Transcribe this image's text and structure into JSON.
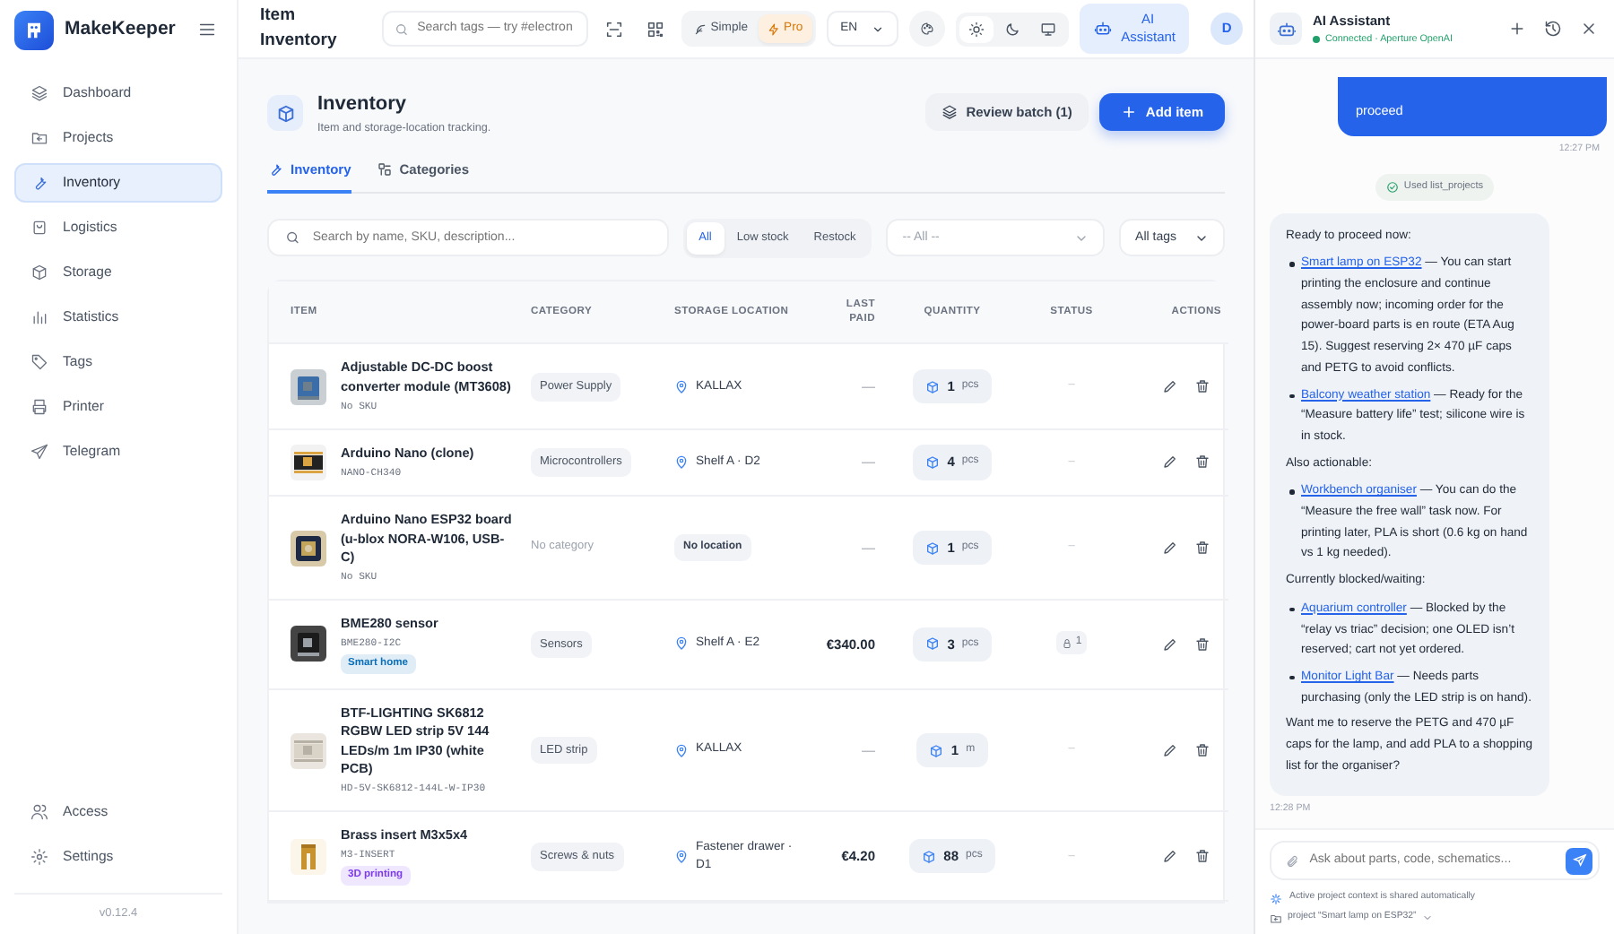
{
  "app": {
    "name": "MakeKeeper"
  },
  "sidebar": {
    "items": [
      {
        "label": "Dashboard",
        "selected": false
      },
      {
        "label": "Projects",
        "selected": false
      },
      {
        "label": "Inventory",
        "selected": true
      },
      {
        "label": "Logistics",
        "selected": false
      },
      {
        "label": "Storage",
        "selected": false
      },
      {
        "label": "Statistics",
        "selected": false
      },
      {
        "label": "Tags",
        "selected": false
      },
      {
        "label": "Printer",
        "selected": false
      },
      {
        "label": "Telegram",
        "selected": false
      }
    ],
    "bottom_items": [
      {
        "label": "Access"
      },
      {
        "label": "Settings"
      }
    ],
    "version": "v0.12.4"
  },
  "topbar": {
    "title": "Item Inventory",
    "search": {
      "placeholder": "Search tags — try #electron"
    },
    "modes": [
      {
        "label": "Simple",
        "selected": false
      },
      {
        "label": "Pro",
        "selected": true
      }
    ],
    "language": "EN",
    "themes": [
      {
        "selected": true
      },
      {
        "selected": false
      },
      {
        "selected": false
      }
    ],
    "assistant_button": {
      "label": "AI Assistant",
      "selected": true
    },
    "avatar": "D"
  },
  "page": {
    "title": "Inventory",
    "subtitle": "Item and storage-location tracking.",
    "buttons": [
      {
        "label": "Review batch (1)",
        "kind": "secondary"
      },
      {
        "label": "Add item",
        "kind": "primary"
      }
    ],
    "tabs": [
      {
        "label": "Inventory",
        "selected": true
      },
      {
        "label": "Categories",
        "selected": false
      }
    ],
    "filters": {
      "search": {
        "placeholder": "Search by name, SKU, description..."
      },
      "stock": [
        {
          "label": "All",
          "selected": true
        },
        {
          "label": "Low stock",
          "selected": false
        },
        {
          "label": "Restock",
          "selected": false
        }
      ],
      "location": {
        "placeholder": "-- All --"
      },
      "tags": {
        "value": "All tags"
      }
    }
  },
  "table": {
    "columns": [
      "ITEM",
      "CATEGORY",
      "STORAGE LOCATION",
      "LAST PAID",
      "QUANTITY",
      "STATUS",
      "ACTIONS"
    ],
    "rows": [
      {
        "name": "Adjustable DC-DC boost converter module (MT3608)",
        "sku": "No SKU",
        "category": {
          "kind": "badge",
          "text": "Power Supply"
        },
        "location": {
          "kind": "pin",
          "text": "KALLAX"
        },
        "last_paid": "—",
        "quantity": {
          "value": "1",
          "unit": "pcs"
        },
        "status": {
          "kind": "dash",
          "text": "–"
        }
      },
      {
        "name": "Arduino Nano (clone)",
        "sku": "NANO-CH340",
        "category": {
          "kind": "badge",
          "text": "Microcontrollers"
        },
        "location": {
          "kind": "pin",
          "text": "Shelf A · D2"
        },
        "last_paid": "—",
        "quantity": {
          "value": "4",
          "unit": "pcs"
        },
        "status": {
          "kind": "dash",
          "text": "–"
        }
      },
      {
        "name": "Arduino Nano ESP32 board (u-blox NORA-W106, USB-C)",
        "sku": "No SKU",
        "category": {
          "kind": "empty",
          "text": "No category"
        },
        "location": {
          "kind": "empty",
          "text": "No location"
        },
        "last_paid": "—",
        "quantity": {
          "value": "1",
          "unit": "pcs"
        },
        "status": {
          "kind": "dash",
          "text": "–"
        }
      },
      {
        "name": "BME280 sensor",
        "sku": "BME280-I2C",
        "tag": {
          "text": "Smart home",
          "color": "#0b6fb8"
        },
        "category": {
          "kind": "badge",
          "text": "Sensors"
        },
        "location": {
          "kind": "pin",
          "text": "Shelf A · E2"
        },
        "last_paid": "€340.00",
        "quantity": {
          "value": "3",
          "unit": "pcs"
        },
        "status": {
          "kind": "lock",
          "text": "1"
        }
      },
      {
        "name": "BTF-LIGHTING SK6812 RGBW LED strip 5V 144 LEDs/m 1m IP30 (white PCB)",
        "sku": "HD-5V-SK6812-144L-W-IP30",
        "category": {
          "kind": "badge",
          "text": "LED strip"
        },
        "location": {
          "kind": "pin",
          "text": "KALLAX"
        },
        "last_paid": "—",
        "quantity": {
          "value": "1",
          "unit": "m"
        },
        "status": {
          "kind": "dash",
          "text": "–"
        }
      },
      {
        "name": "Brass insert M3x5x4",
        "sku": "M3-INSERT",
        "tag": {
          "text": "3D printing",
          "color": "#7c3aed"
        },
        "category": {
          "kind": "badge",
          "text": "Screws & nuts"
        },
        "location": {
          "kind": "pin",
          "text": "Fastener drawer · D1"
        },
        "last_paid": "€4.20",
        "quantity": {
          "value": "88",
          "unit": "pcs"
        },
        "status": {
          "kind": "dash",
          "text": "–"
        }
      }
    ]
  },
  "assistant": {
    "title": "AI Assistant",
    "status": "Connected · Aperture OpenAI",
    "connected": true,
    "messages": [
      {
        "kind": "user",
        "text": "proceed"
      },
      {
        "kind": "time",
        "text": "12:27 PM"
      },
      {
        "kind": "tool",
        "text": "Used list_projects"
      },
      {
        "kind": "assistant",
        "blocks": [
          {
            "kind": "paragraph",
            "text": "Ready to proceed now:"
          },
          {
            "kind": "list",
            "items": [
              {
                "link": "Smart lamp on ESP32",
                "text": " — You can start printing the enclosure and continue assembly now; incoming order for the power-board parts is en route (ETA Aug 15). Suggest reserving 2× 470 µF caps and PETG to avoid conflicts."
              },
              {
                "link": "Balcony weather station",
                "text": " — Ready for the “Measure battery life” test; silicone wire is in stock."
              }
            ]
          },
          {
            "kind": "paragraph",
            "text": "Also actionable:"
          },
          {
            "kind": "list",
            "items": [
              {
                "link": "Workbench organiser",
                "text": " — You can do the “Measure the free wall” task now. For printing later, PLA is short (0.6 kg on hand vs 1 kg needed)."
              }
            ]
          },
          {
            "kind": "paragraph",
            "text": "Currently blocked/waiting:"
          },
          {
            "kind": "list",
            "items": [
              {
                "link": "Aquarium controller",
                "text": " — Blocked by the “relay vs triac” decision; one OLED isn’t reserved; cart not yet ordered."
              },
              {
                "link": "Monitor Light Bar",
                "text": " — Needs parts purchasing (only the LED strip is on hand)."
              }
            ]
          },
          {
            "kind": "paragraph",
            "text": "Want me to reserve the PETG and 470 µF caps for the lamp, and add PLA to a shopping list for the organiser?"
          }
        ]
      },
      {
        "kind": "time",
        "text": "12:28 PM"
      }
    ],
    "input": {
      "placeholder": "Ask about parts, code, schematics..."
    },
    "context_note": "Active project context is shared automatically",
    "project": "project “Smart lamp on ESP32”"
  }
}
